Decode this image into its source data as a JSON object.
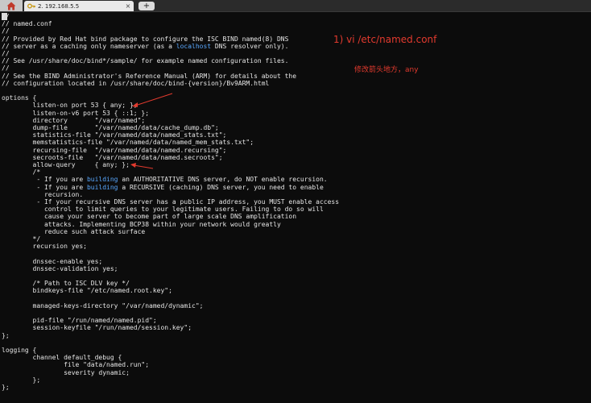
{
  "tabbar": {
    "home_icon": "home-icon",
    "tab_label": "2. 192.168.5.5",
    "tab_icon": "key-icon",
    "close_glyph": "×",
    "newtab_glyph": "+"
  },
  "colors": {
    "background": "#0c0c0c",
    "text": "#e6e6e6",
    "highlight": "#59a8ff",
    "annotation": "#e23a2e"
  },
  "file": {
    "lines": [
      {
        "t": "//"
      },
      {
        "t": "// named.conf"
      },
      {
        "t": "//"
      },
      {
        "t": "// Provided by Red Hat bind package to configure the ISC BIND named(8) DNS"
      },
      {
        "t": "// server as a caching only nameserver (as a ",
        "h": "localhost",
        "a": " DNS resolver only)."
      },
      {
        "t": "//"
      },
      {
        "t": "// See /usr/share/doc/bind*/sample/ for example named configuration files."
      },
      {
        "t": "//"
      },
      {
        "t": "// See the BIND Administrator's Reference Manual (ARM) for details about the"
      },
      {
        "t": "// configuration located in /usr/share/doc/bind-{version}/Bv9ARM.html"
      },
      {
        "t": ""
      },
      {
        "t": "options {"
      },
      {
        "t": "        listen-on port 53 { any; };"
      },
      {
        "t": "        listen-on-v6 port 53 { ::1; };"
      },
      {
        "t": "        directory       \"/var/named\";"
      },
      {
        "t": "        dump-file       \"/var/named/data/cache_dump.db\";"
      },
      {
        "t": "        statistics-file \"/var/named/data/named_stats.txt\";"
      },
      {
        "t": "        memstatistics-file \"/var/named/data/named_mem_stats.txt\";"
      },
      {
        "t": "        recursing-file  \"/var/named/data/named.recursing\";"
      },
      {
        "t": "        secroots-file   \"/var/named/data/named.secroots\";"
      },
      {
        "t": "        allow-query     { any; };"
      },
      {
        "t": "        /*"
      },
      {
        "t": "         - If you are ",
        "h": "building",
        "a": " an AUTHORITATIVE DNS server, do NOT enable recursion."
      },
      {
        "t": "         - If you are ",
        "h": "building",
        "a": " a RECURSIVE (caching) DNS server, you need to enable"
      },
      {
        "t": "           recursion."
      },
      {
        "t": "         - If your recursive DNS server has a public IP address, you MUST enable access"
      },
      {
        "t": "           control to limit queries to your legitimate users. Failing to do so will"
      },
      {
        "t": "           cause your server to become part of large scale DNS amplification"
      },
      {
        "t": "           attacks. Implementing BCP38 within your network would greatly"
      },
      {
        "t": "           reduce such attack surface"
      },
      {
        "t": "        */"
      },
      {
        "t": "        recursion yes;"
      },
      {
        "t": ""
      },
      {
        "t": "        dnssec-enable yes;"
      },
      {
        "t": "        dnssec-validation yes;"
      },
      {
        "t": ""
      },
      {
        "t": "        /* Path to ISC DLV key */"
      },
      {
        "t": "        bindkeys-file \"/etc/named.root.key\";"
      },
      {
        "t": ""
      },
      {
        "t": "        managed-keys-directory \"/var/named/dynamic\";"
      },
      {
        "t": ""
      },
      {
        "t": "        pid-file \"/run/named/named.pid\";"
      },
      {
        "t": "        session-keyfile \"/run/named/session.key\";"
      },
      {
        "t": "};"
      },
      {
        "t": ""
      },
      {
        "t": "logging {"
      },
      {
        "t": "        channel default_debug {"
      },
      {
        "t": "                file \"data/named.run\";"
      },
      {
        "t": "                severity dynamic;"
      },
      {
        "t": "        };"
      },
      {
        "t": "};"
      }
    ]
  },
  "annotations": {
    "step": "1)  vi /etc/named.conf",
    "note": "修改箭头地方，any"
  }
}
